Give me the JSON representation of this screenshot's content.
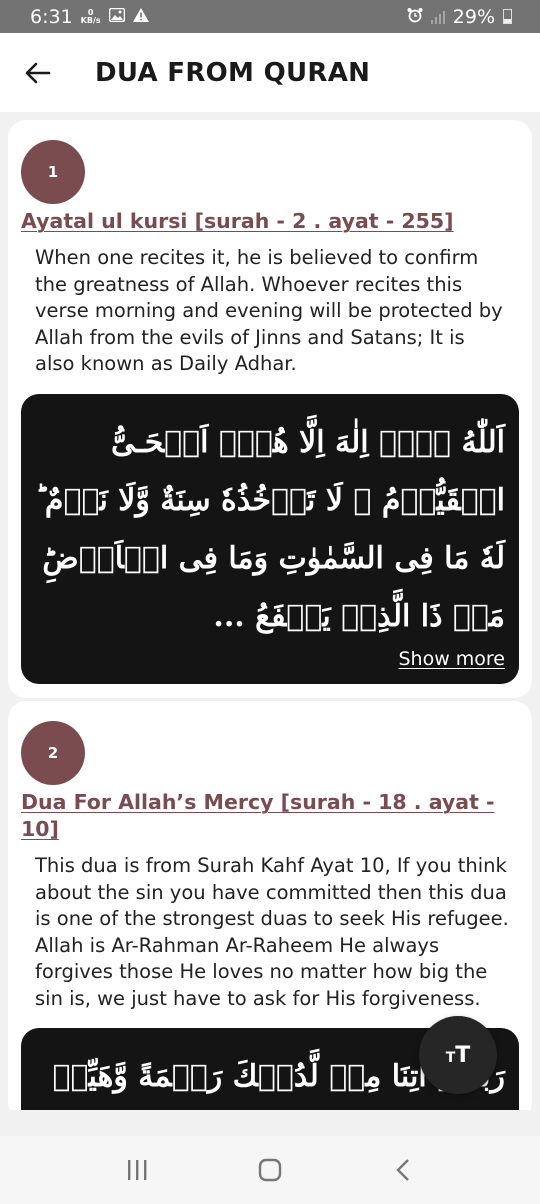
{
  "status_bar": {
    "time": "6:31",
    "net_speed_value": "0",
    "net_speed_unit": "KB/s",
    "battery": "29%",
    "icons": [
      "gallery-icon",
      "warning-icon",
      "alarm-icon",
      "signal-icon",
      "battery-icon"
    ]
  },
  "app_bar": {
    "back_icon": "arrow-left-icon",
    "title": "DUA FROM QURAN"
  },
  "duas": [
    {
      "number": "1",
      "title": "Ayatal ul kursi [surah - 2 . ayat - 255]",
      "description": "When one recites it, he is believed to confirm the greatness of Allah. Whoever recites this verse morning and evening will be protected by Allah from the evils of Jinns and Satans; It is also known as Daily Adhar.",
      "arabic": "اَللّٰهُ لَاۤ اِلٰهَ اِلَّا هُوَۚ اَلۡحَـىُّ الۡقَيُّوۡمُ  ۚ لَا تَاۡخُذُهٗ سِنَةٌ وَّلَا نَوۡمٌ‌ ؕ لَهٗ مَا فِى السَّمٰوٰتِ وَمَا فِى الۡاَرۡضِ‌ؕ مَنۡ ذَا الَّذِىۡ يَشۡفَعُ ...",
      "show_more": "Show more"
    },
    {
      "number": "2",
      "title": "Dua For Allah’s Mercy [surah - 18 . ayat - 10]",
      "description": "This dua is from Surah Kahf Ayat 10, If you think about the sin you have committed then this dua is one of the strongest duas to seek His refugee. Allah is Ar-Rahman Ar-Raheem He always forgives those He loves no matter how big the sin is, we just have to ask for His forgiveness.",
      "arabic": "رَبَّنَاۤ اٰتِنَا مِنۡ لَّدُنۡكَ رَحۡمَةً وَّهَيِّئۡ لَنَا"
    }
  ],
  "fab": {
    "icon": "text-size-icon",
    "label_small": "T",
    "label_large": "T"
  },
  "nav_bar": {
    "recents_icon": "recent-apps-icon",
    "home_icon": "home-icon",
    "back_icon": "back-icon"
  },
  "colors": {
    "accent": "#7a4b4f",
    "status_bar": "#737373",
    "arabic_bg": "#141414",
    "page_bg": "#f1f1f1"
  }
}
